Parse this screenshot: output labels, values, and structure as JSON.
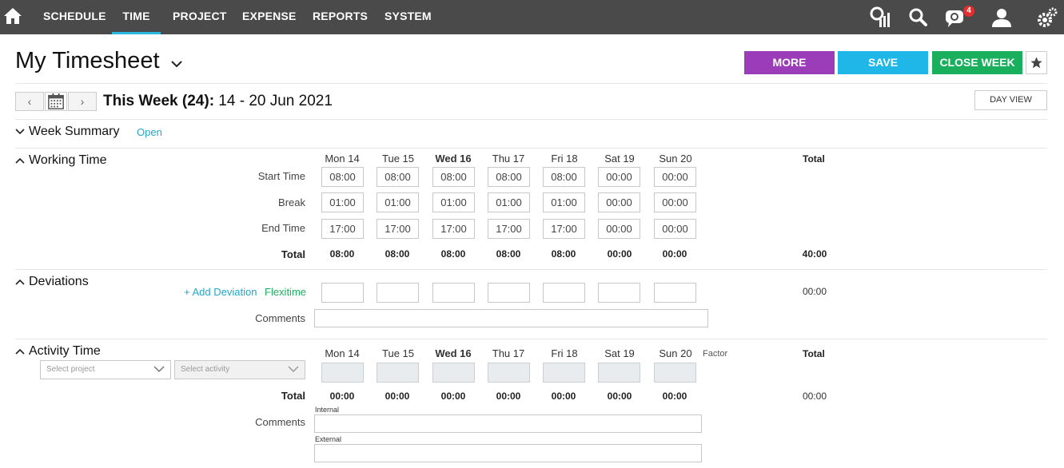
{
  "nav": {
    "items": [
      "SCHEDULE",
      "TIME",
      "PROJECT",
      "EXPENSE",
      "REPORTS",
      "SYSTEM"
    ],
    "active": "TIME",
    "notification_count": "4",
    "icons": [
      "home-icon",
      "analytics-icon",
      "search-icon",
      "chat-icon",
      "user-icon",
      "settings-icon"
    ]
  },
  "header": {
    "title": "My Timesheet",
    "more_label": "MORE",
    "save_label": "SAVE",
    "close_week_label": "CLOSE WEEK"
  },
  "week": {
    "label_bold": "This Week (24):",
    "label_range": " 14 - 20 Jun 2021",
    "day_view_label": "DAY VIEW"
  },
  "week_summary": {
    "title": "Week Summary",
    "open_label": "Open"
  },
  "working_time": {
    "title": "Working Time",
    "days": [
      "Mon 14",
      "Tue 15",
      "Wed 16",
      "Thu 17",
      "Fri 18",
      "Sat 19",
      "Sun 20"
    ],
    "total_header": "Total",
    "rows": [
      {
        "label": "Start Time",
        "values": [
          "08:00",
          "08:00",
          "08:00",
          "08:00",
          "08:00",
          "00:00",
          "00:00"
        ]
      },
      {
        "label": "Break",
        "values": [
          "01:00",
          "01:00",
          "01:00",
          "01:00",
          "01:00",
          "00:00",
          "00:00"
        ]
      },
      {
        "label": "End Time",
        "values": [
          "17:00",
          "17:00",
          "17:00",
          "17:00",
          "17:00",
          "00:00",
          "00:00"
        ]
      }
    ],
    "total_label": "Total",
    "totals": [
      "08:00",
      "08:00",
      "08:00",
      "08:00",
      "08:00",
      "00:00",
      "00:00"
    ],
    "grand_total": "40:00"
  },
  "deviations": {
    "title": "Deviations",
    "add_label": "+ Add Deviation",
    "type_label": "Flexitime",
    "total": "00:00",
    "comments_label": "Comments"
  },
  "activity_time": {
    "title": "Activity Time",
    "days": [
      "Mon 14",
      "Tue 15",
      "Wed 16",
      "Thu 17",
      "Fri 18",
      "Sat 19",
      "Sun 20"
    ],
    "factor_label": "Factor",
    "total_header": "Total",
    "project_placeholder": "Select project",
    "activity_placeholder": "Select activity",
    "total_label": "Total",
    "totals": [
      "00:00",
      "00:00",
      "00:00",
      "00:00",
      "00:00",
      "00:00",
      "00:00"
    ],
    "grand_total": "00:00",
    "comments_label": "Comments",
    "internal_label": "Internal",
    "external_label": "External"
  }
}
